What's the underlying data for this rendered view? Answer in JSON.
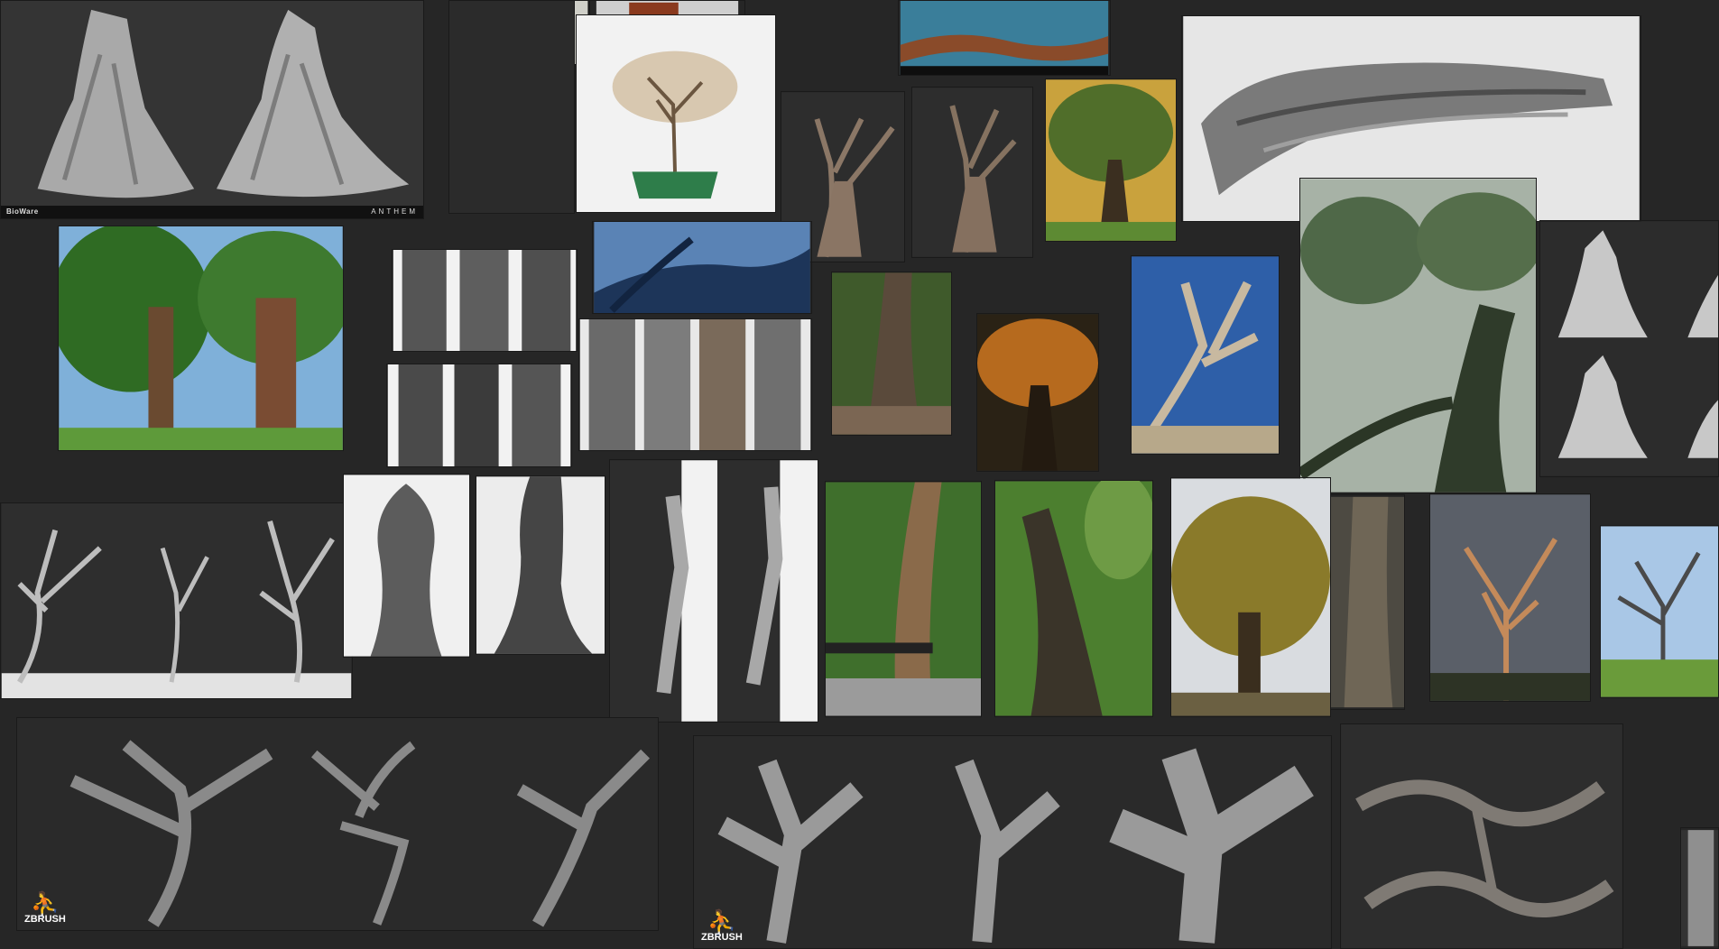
{
  "board": {
    "caption_bioware": {
      "brand": "BioWare",
      "product": "ANTHEM"
    },
    "zbrush_label_a": "ZBRUSH",
    "zbrush_label_b": "ZBRUSH"
  },
  "colors": {
    "background": "#262626",
    "sculpt_gray": "#9a9a9a",
    "foliage_green": "#3f6f2c",
    "autumn_orange": "#b66a1e",
    "sky_blue": "#3a6fb0"
  }
}
